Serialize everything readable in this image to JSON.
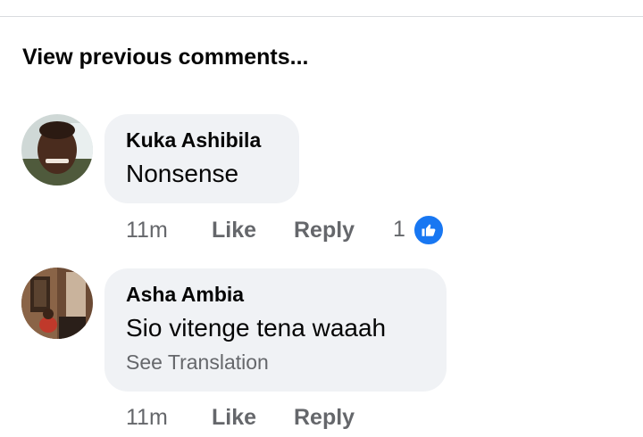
{
  "header": {
    "view_previous_label": "View previous comments..."
  },
  "comments": [
    {
      "author": "Kuka Ashibila",
      "text": "Nonsense",
      "time": "11m",
      "like_label": "Like",
      "reply_label": "Reply",
      "reaction_count": "1",
      "reaction_icon": "like-icon"
    },
    {
      "author": "Asha Ambia",
      "text": "Sio vitenge tena waaah",
      "translation_label": "See Translation",
      "time": "11m",
      "like_label": "Like",
      "reply_label": "Reply"
    }
  ],
  "colors": {
    "bubble": "#f0f2f5",
    "secondary_text": "#65676b",
    "like_blue": "#1877f2"
  }
}
